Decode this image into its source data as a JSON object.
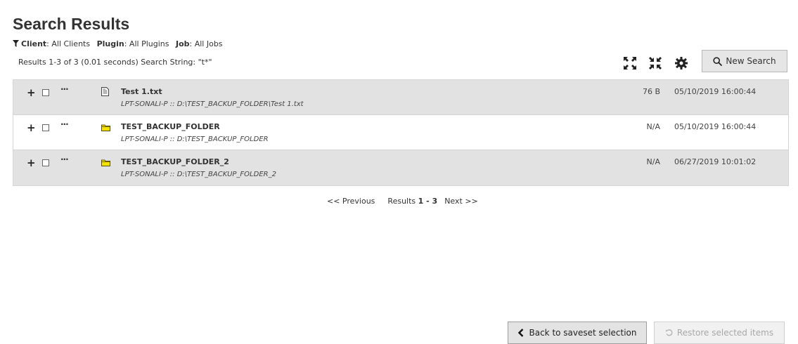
{
  "page": {
    "title": "Search Results"
  },
  "filters": {
    "client_label": "Client",
    "client_value": ": All Clients",
    "plugin_label": "Plugin",
    "plugin_value": ": All Plugins",
    "job_label": "Job",
    "job_value": ": All Jobs",
    "icon": "funnel-icon"
  },
  "summary": "Results 1-3 of 3 (0.01 seconds) Search String: \"t*\"",
  "toolbar": {
    "expand_icon": "expand-icon",
    "collapse_icon": "collapse-icon",
    "settings_icon": "gear-icon",
    "new_search_label": "New Search",
    "new_search_icon": "search-icon"
  },
  "results": [
    {
      "type": "file",
      "name": "Test 1.txt",
      "path": "LPT-SONALI-P :: D:\\TEST_BACKUP_FOLDER\\Test 1.txt",
      "size": "76 B",
      "date": "05/10/2019 16:00:44",
      "plus": "+",
      "dots": "···"
    },
    {
      "type": "folder",
      "name": "TEST_BACKUP_FOLDER",
      "path": "LPT-SONALI-P :: D:\\TEST_BACKUP_FOLDER",
      "size": "N/A",
      "date": "05/10/2019 16:00:44",
      "plus": "+",
      "dots": "···"
    },
    {
      "type": "folder",
      "name": "TEST_BACKUP_FOLDER_2",
      "path": "LPT-SONALI-P :: D:\\TEST_BACKUP_FOLDER_2",
      "size": "N/A",
      "date": "06/27/2019 10:01:02",
      "plus": "+",
      "dots": "···"
    }
  ],
  "pager": {
    "previous": "<< Previous",
    "results_label": "Results",
    "range": "1 - 3",
    "next": "Next >>"
  },
  "actions": {
    "back_label": "Back to saveset selection",
    "restore_label": "Restore selected items",
    "restore_enabled": false
  },
  "colors": {
    "row_alt": "#e2e2e2",
    "folder_fill": "#f2e000",
    "button_bg": "#e3e3e3"
  }
}
